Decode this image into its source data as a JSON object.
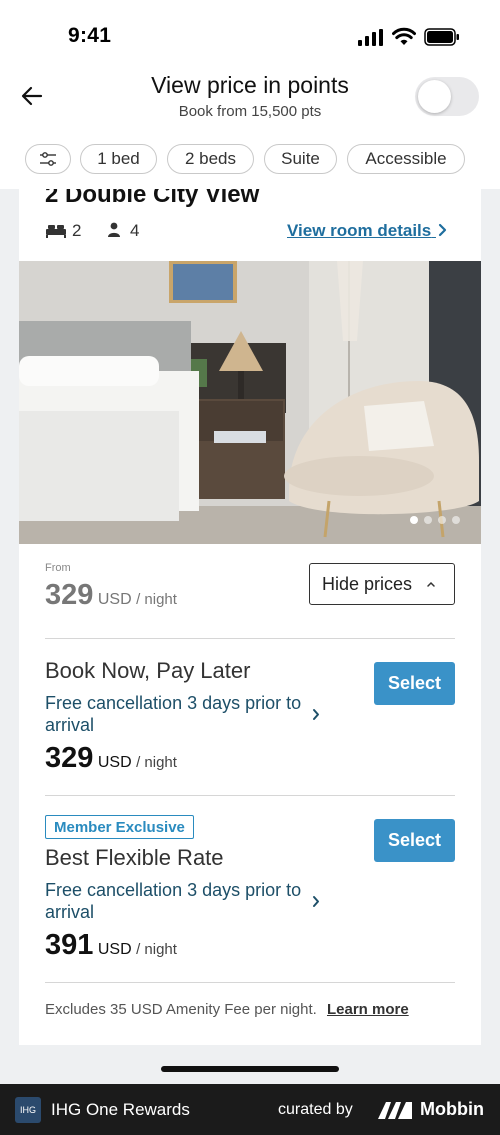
{
  "status_bar": {
    "time": "9:41"
  },
  "header": {
    "title": "View price in points",
    "subtitle": "Book from 15,500 pts",
    "points_toggle_on": false
  },
  "filters": {
    "chips": [
      "1 bed",
      "2 beds",
      "Suite",
      "Accessible"
    ]
  },
  "room": {
    "title": "2 Double City View",
    "beds": "2",
    "guests": "4",
    "details_link": "View room details",
    "photo_count": 4,
    "active_photo": 1
  },
  "pricing": {
    "from_label": "From",
    "from_price": "329",
    "currency": "USD",
    "per_night": "/ night",
    "hide_prices_label": "Hide prices"
  },
  "rates": [
    {
      "badge": "",
      "title": "Book Now, Pay Later",
      "description": "Free cancellation 3 days prior to arrival",
      "price": "329",
      "select_label": "Select"
    },
    {
      "badge": "Member Exclusive",
      "title": "Best Flexible Rate",
      "description": "Free cancellation 3 days prior to arrival",
      "price": "391",
      "select_label": "Select"
    }
  ],
  "note": {
    "text": "Excludes 35 USD Amenity Fee per night.",
    "link": "Learn more"
  },
  "footer": {
    "logo_text": "IHG",
    "app_name": "IHG One Rewards",
    "curated_by": "curated by",
    "brand": "Mobbin"
  },
  "colors": {
    "accent_blue": "#3a92c8",
    "link_blue": "#1f6e9e",
    "desc_blue": "#1d4f68",
    "page_grey": "#eef0f2",
    "footer_bg": "#1b1b1b"
  }
}
